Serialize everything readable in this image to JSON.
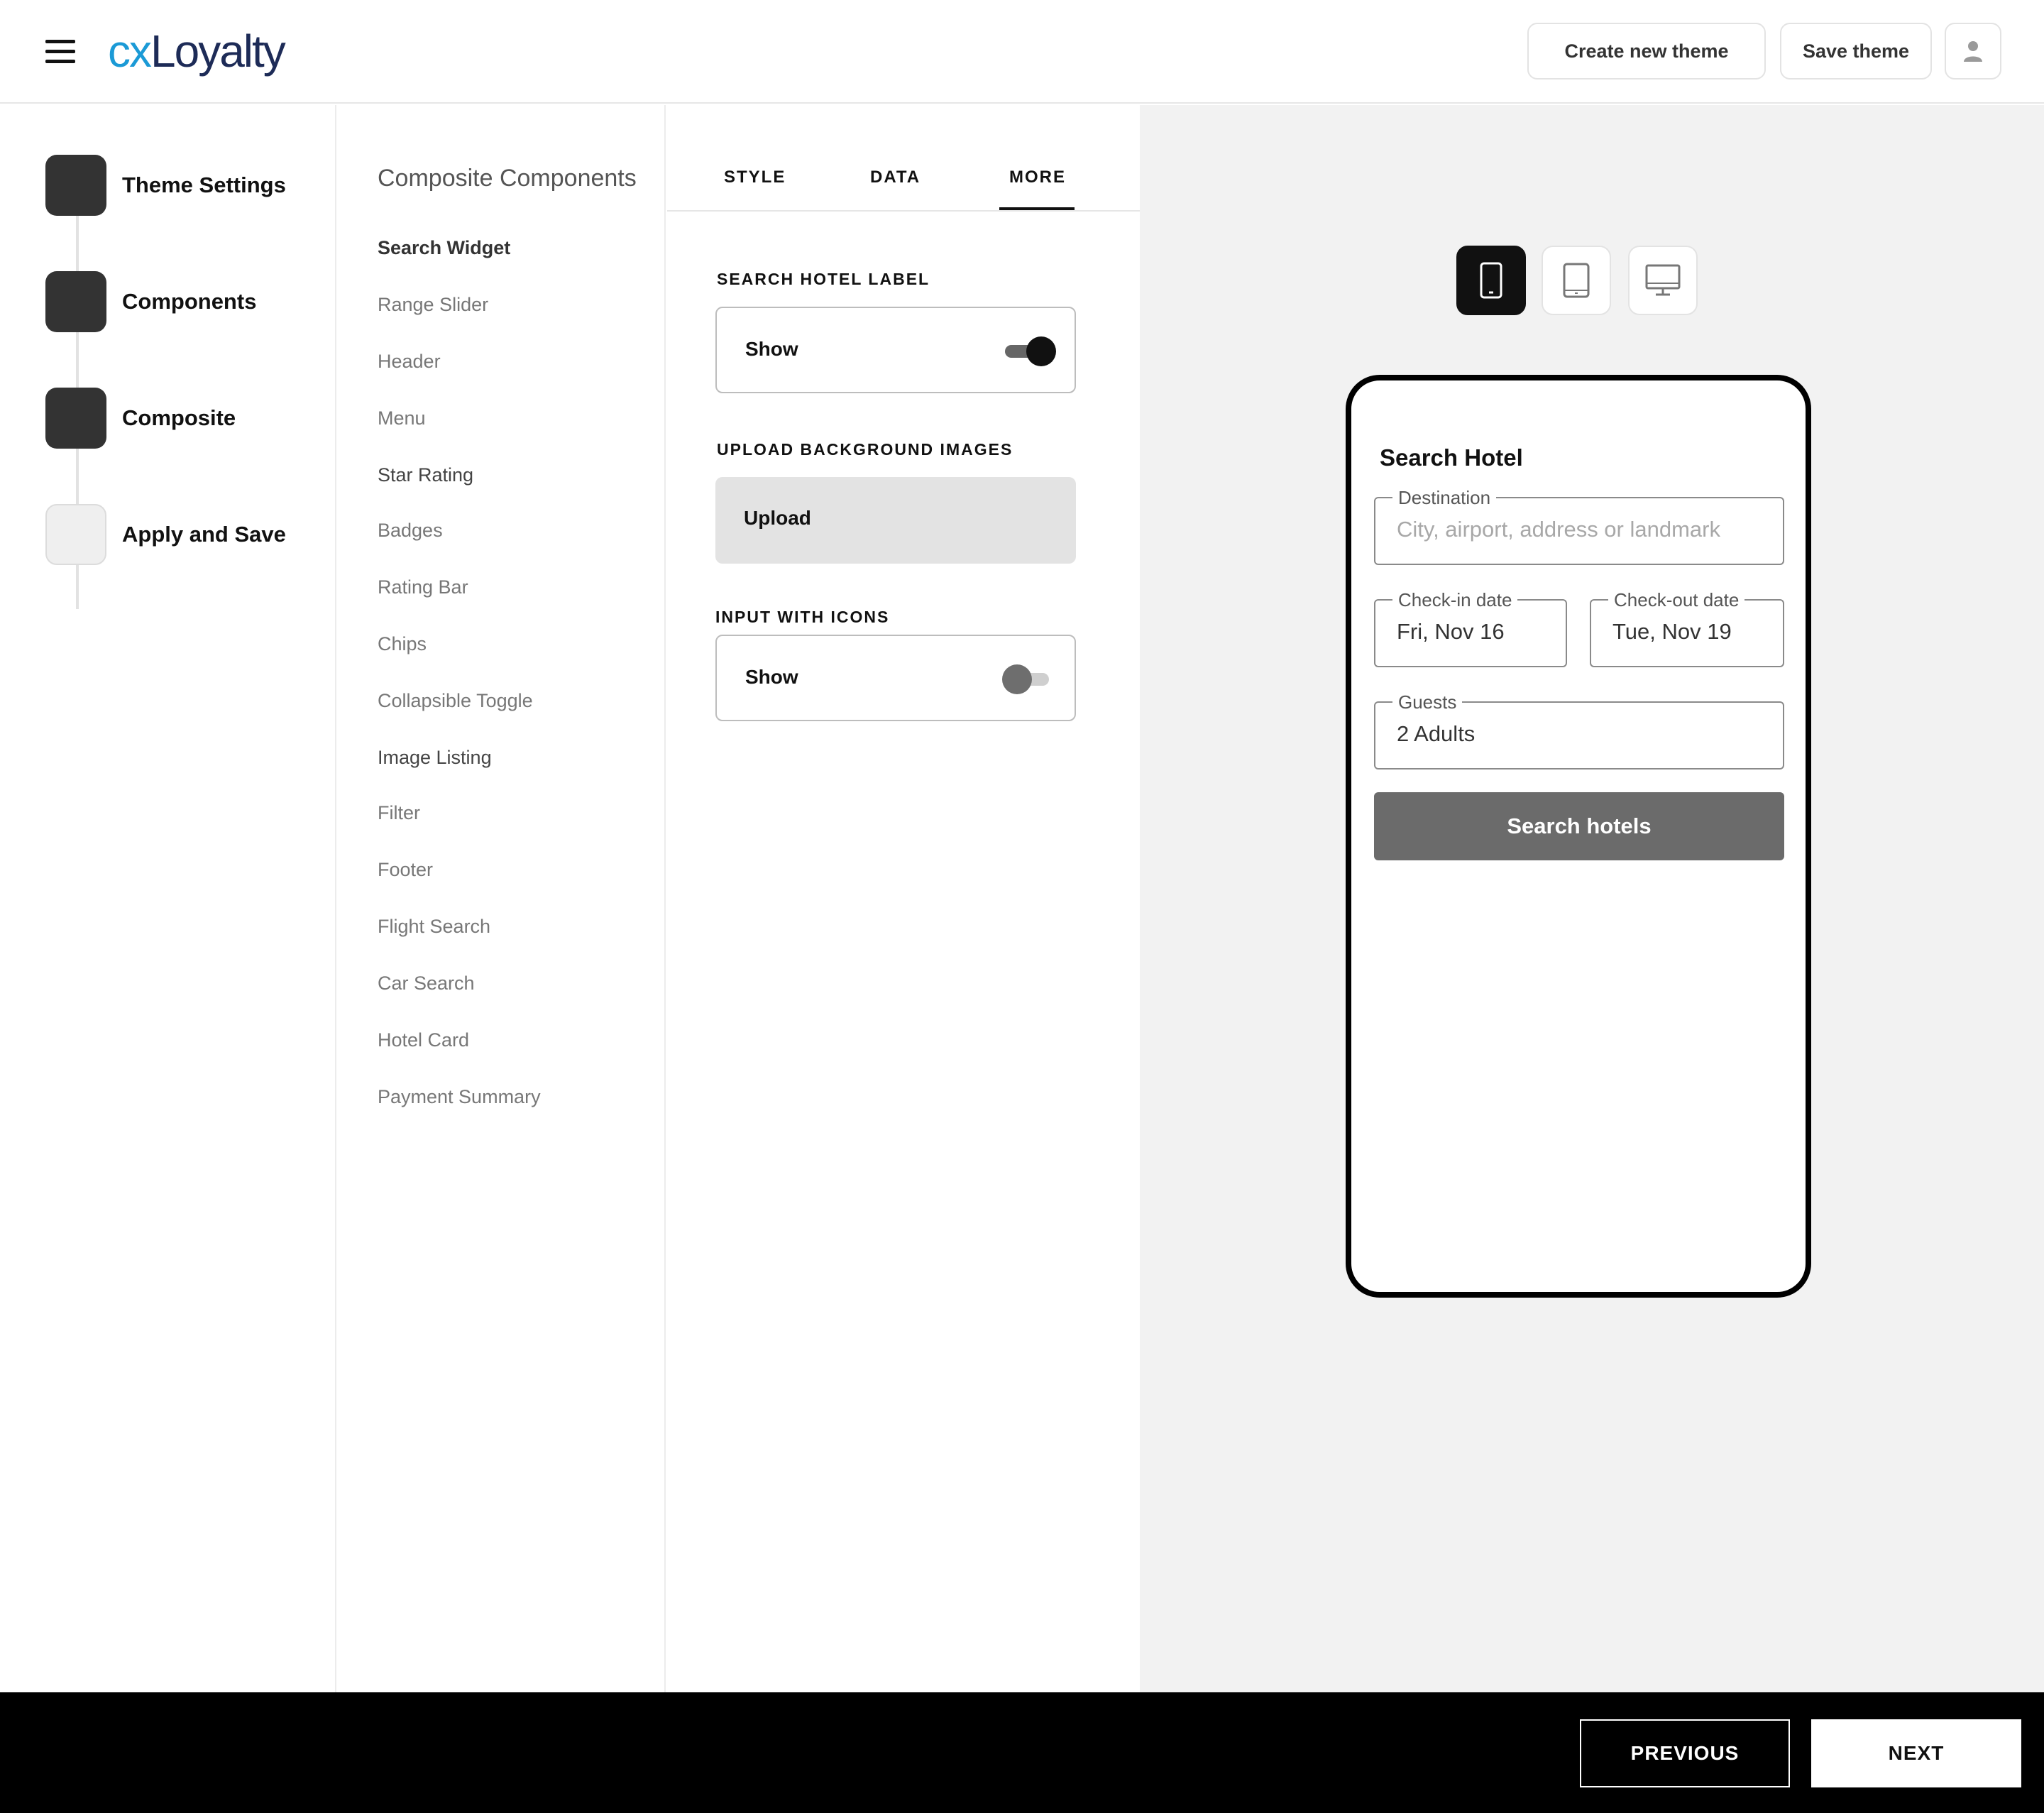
{
  "header": {
    "logo_prefix": "cx",
    "logo_suffix": "Loyalty",
    "create_label": "Create new theme",
    "save_label": "Save theme"
  },
  "steps": [
    {
      "label": "Theme Settings",
      "done": true
    },
    {
      "label": "Components",
      "done": true
    },
    {
      "label": "Composite",
      "done": true
    },
    {
      "label": "Apply and Save",
      "done": false
    }
  ],
  "components": {
    "title": "Composite Components",
    "items": [
      "Search Widget",
      "Range Slider",
      "Header",
      "Menu",
      "Star Rating",
      "Badges",
      "Rating Bar",
      "Chips",
      "Collapsible Toggle",
      "Image Listing",
      "Filter",
      "Footer",
      "Flight Search",
      "Car Search",
      "Hotel Card",
      "Payment Summary"
    ],
    "active": "Search Widget"
  },
  "panel": {
    "tabs": [
      "STYLE",
      "DATA",
      "MORE"
    ],
    "active_tab": "MORE",
    "search_label_title": "SEARCH HOTEL LABEL",
    "search_label_toggle_text": "Show",
    "search_label_on": true,
    "upload_title": "UPLOAD BACKGROUND IMAGES",
    "upload_label": "Upload",
    "icons_title": "INPUT WITH ICONS",
    "icons_toggle_text": "Show",
    "icons_on": false
  },
  "preview": {
    "devices": [
      "mobile-icon",
      "tablet-icon",
      "desktop-icon"
    ],
    "active_device": "mobile",
    "title": "Search Hotel",
    "destination_label": "Destination",
    "destination_placeholder": "City, airport, address or landmark",
    "checkin_label": "Check-in date",
    "checkin_value": "Fri, Nov 16",
    "checkout_label": "Check-out date",
    "checkout_value": "Tue, Nov 19",
    "guests_label": "Guests",
    "guests_value": "2 Adults",
    "search_button": "Search hotels"
  },
  "footer": {
    "previous_label": "PREVIOUS",
    "next_label": "NEXT"
  },
  "colors": {
    "brand_cx": "#1b9ad6",
    "brand_loyalty": "#1d2b57",
    "preview_bg": "#f2f2f2",
    "footer_bg": "#000000"
  }
}
